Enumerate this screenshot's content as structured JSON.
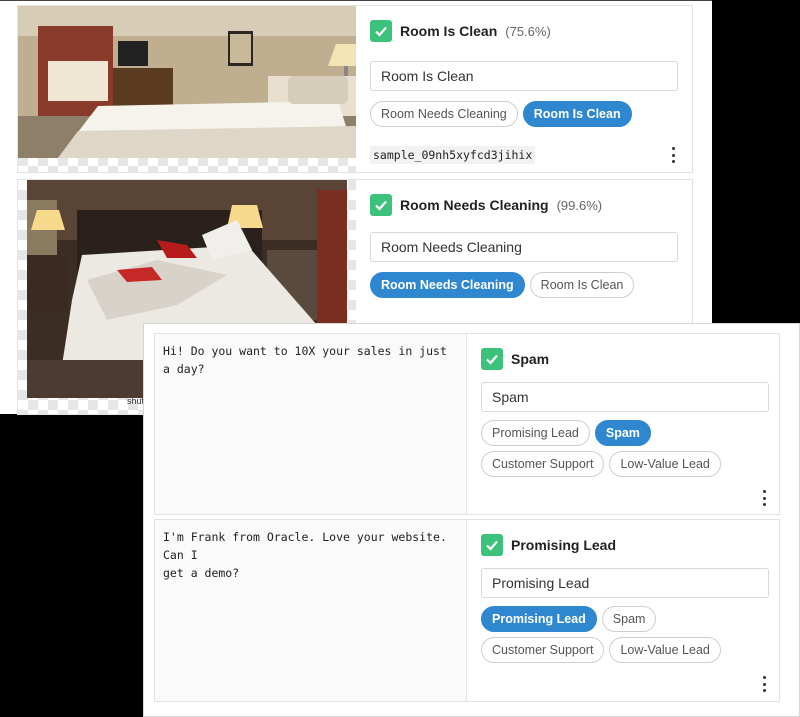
{
  "image_cards": [
    {
      "label": "Room Is Clean",
      "confidence": "(75.6%)",
      "field_value": "Room Is Clean",
      "chips": [
        {
          "label": "Room Needs Cleaning",
          "selected": false
        },
        {
          "label": "Room Is Clean",
          "selected": true
        }
      ],
      "sample_id": "sample_09nh5xyfcd3jihix"
    },
    {
      "label": "Room Needs Cleaning",
      "confidence": "(99.6%)",
      "field_value": "Room Needs Cleaning",
      "chips": [
        {
          "label": "Room Needs Cleaning",
          "selected": true
        },
        {
          "label": "Room Is Clean",
          "selected": false
        }
      ]
    }
  ],
  "image_watermark": "shut",
  "text_cards": [
    {
      "text": "Hi! Do you want to 10X your sales in just a day?",
      "label": "Spam",
      "field_value": "Spam",
      "chips": [
        {
          "label": "Promising Lead",
          "selected": false
        },
        {
          "label": "Spam",
          "selected": true
        },
        {
          "label": "Customer Support",
          "selected": false
        },
        {
          "label": "Low-Value Lead",
          "selected": false
        }
      ]
    },
    {
      "text": "I'm Frank from Oracle. Love your website. Can I\nget a demo?",
      "label": "Promising Lead",
      "field_value": "Promising Lead",
      "chips": [
        {
          "label": "Promising Lead",
          "selected": true
        },
        {
          "label": "Spam",
          "selected": false
        },
        {
          "label": "Customer Support",
          "selected": false
        },
        {
          "label": "Low-Value Lead",
          "selected": false
        }
      ]
    }
  ],
  "colors": {
    "accent": "#2f87d0",
    "check": "#3cc27a"
  },
  "icons": [
    "check-icon",
    "kebab-menu-icon"
  ]
}
